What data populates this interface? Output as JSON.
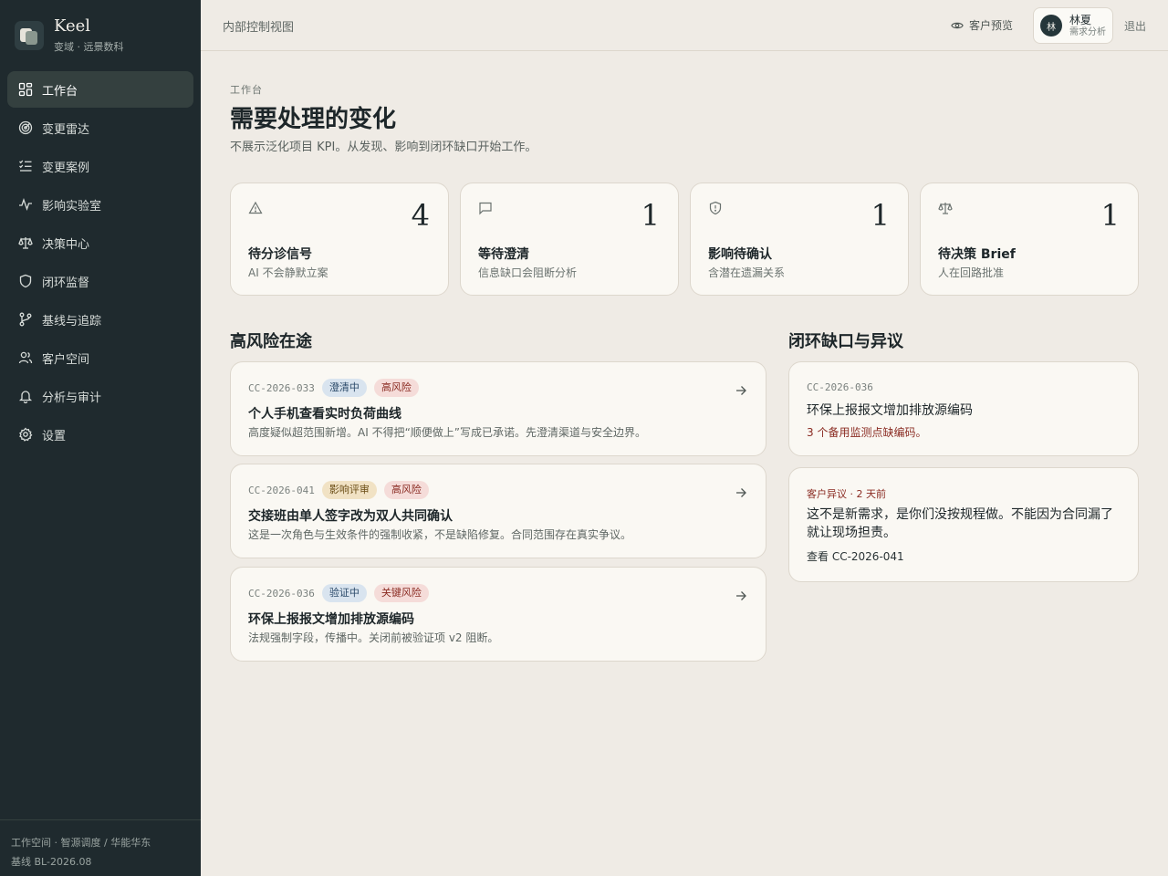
{
  "brand": {
    "name": "Keel",
    "subtitle": "变域 · 远景数科"
  },
  "sidebar": {
    "items": [
      {
        "label": "工作台",
        "icon": "dashboard-icon",
        "active": true
      },
      {
        "label": "变更雷达",
        "icon": "radar-icon"
      },
      {
        "label": "变更案例",
        "icon": "checklist-icon"
      },
      {
        "label": "影响实验室",
        "icon": "activity-icon"
      },
      {
        "label": "决策中心",
        "icon": "scale-icon"
      },
      {
        "label": "闭环监督",
        "icon": "shield-icon"
      },
      {
        "label": "基线与追踪",
        "icon": "git-branch-icon"
      },
      {
        "label": "客户空间",
        "icon": "users-icon"
      },
      {
        "label": "分析与审计",
        "icon": "bell-icon"
      },
      {
        "label": "设置",
        "icon": "gear-icon"
      }
    ],
    "footer": {
      "workspace": "工作空间 · 智源调度 / 华能华东",
      "baseline": "基线 BL-2026.08"
    }
  },
  "topbar": {
    "title": "内部控制视图",
    "preview_label": "客户预览",
    "user": {
      "avatar": "林",
      "name": "林夏",
      "role": "需求分析"
    },
    "logout_label": "退出"
  },
  "header": {
    "eyebrow": "工作台",
    "title": "需要处理的变化",
    "description": "不展示泛化项目 KPI。从发现、影响到闭环缺口开始工作。"
  },
  "stats": [
    {
      "icon": "alert-triangle-icon",
      "value": "4",
      "title": "待分诊信号",
      "subtitle": "AI 不会静默立案"
    },
    {
      "icon": "message-square-icon",
      "value": "1",
      "title": "等待澄清",
      "subtitle": "信息缺口会阻断分析"
    },
    {
      "icon": "shield-alert-icon",
      "value": "1",
      "title": "影响待确认",
      "subtitle": "含潜在遗漏关系"
    },
    {
      "icon": "scale-icon",
      "value": "1",
      "title": "待决策 Brief",
      "subtitle": "人在回路批准"
    }
  ],
  "risk_section": {
    "title": "高风险在途",
    "cases": [
      {
        "code": "CC-2026-033",
        "status": "澄清中",
        "risk": "高风险",
        "title": "个人手机查看实时负荷曲线",
        "desc": "高度疑似超范围新增。AI 不得把“顺便做上”写成已承诺。先澄清渠道与安全边界。"
      },
      {
        "code": "CC-2026-041",
        "status": "影响评审",
        "risk": "高风险",
        "title": "交接班由单人签字改为双人共同确认",
        "desc": "这是一次角色与生效条件的强制收紧，不是缺陷修复。合同范围存在真实争议。"
      },
      {
        "code": "CC-2026-036",
        "status": "验证中",
        "risk": "关键风险",
        "title": "环保上报报文增加排放源编码",
        "desc": "法规强制字段，传播中。关闭前被验证项 v2 阻断。"
      }
    ]
  },
  "gap_section": {
    "title": "闭环缺口与异议",
    "gap": {
      "code": "CC-2026-036",
      "title": "环保上报报文增加排放源编码",
      "warning": "3 个备用监测点缺编码。"
    },
    "objection": {
      "meta": "客户异议 · 2 天前",
      "quote": "这不是新需求，是你们没按规程做。不能因为合同漏了就让现场担责。",
      "link": "查看 CC-2026-041"
    }
  },
  "colors": {
    "sidebar_bg": "#1f2a2e",
    "page_bg": "#efebe5",
    "card_bg": "#faf8f3",
    "danger": "#8a2b22"
  }
}
